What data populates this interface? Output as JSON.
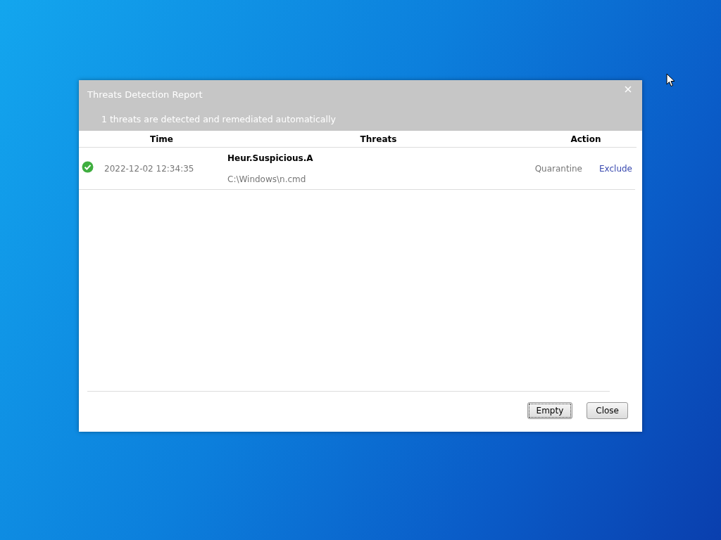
{
  "window": {
    "title": "Threats Detection Report",
    "summary": "1 threats are detected and remediated automatically"
  },
  "table": {
    "columns": [
      "Time",
      "Threats",
      "Action"
    ],
    "rows": [
      {
        "remediated": true,
        "time": "2022-12-02 12:34:35",
        "threat": "Heur.Suspicious.A",
        "path": "C:\\Windows\\n.cmd",
        "action": "Quarantine",
        "link": "Exclude"
      }
    ]
  },
  "buttons": [
    {
      "label": "Empty",
      "focused": true
    },
    {
      "label": "Close",
      "focused": false
    }
  ]
}
